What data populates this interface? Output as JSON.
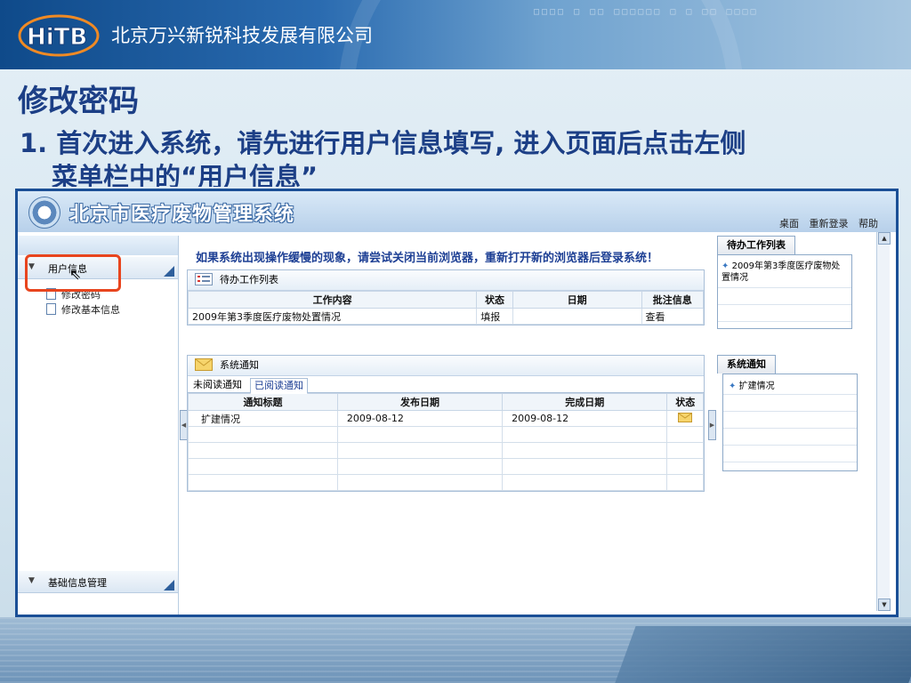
{
  "slide": {
    "company": "北京万兴新锐科技发展有限公司",
    "logo_text": "HiTB",
    "heading": "修改密码",
    "step_line1": "1. 首次进入系统，请先进行用户信息填写, 进入页面后点击左侧",
    "step_line2": "菜单栏中的“用户信息”"
  },
  "app": {
    "title": "北京市医疗废物管理系统",
    "top_links": [
      "桌面",
      "重新登录",
      "帮助"
    ],
    "sidebar": {
      "section1": "用户信息",
      "items": [
        "修改密码",
        "修改基本信息"
      ],
      "section2": "基础信息管理"
    },
    "notice": "如果系统出现操作缓慢的现象，请尝试关闭当前浏览器，重新打开新的浏览器后登录系统！",
    "todo_panel": {
      "title": "待办工作列表",
      "headers": [
        "工作内容",
        "状态",
        "日期",
        "批注信息"
      ],
      "rows": [
        [
          "2009年第3季度医疗废物处置情况",
          "填报",
          "",
          "查看"
        ]
      ]
    },
    "notice_panel": {
      "title": "系统通知",
      "tabs": [
        "未阅读通知",
        "已阅读通知"
      ],
      "headers": [
        "通知标题",
        "发布日期",
        "完成日期",
        "状态"
      ],
      "rows": [
        [
          "扩建情况",
          "2009-08-12",
          "2009-08-12",
          ""
        ]
      ]
    },
    "right": {
      "todo_tab": "待办工作列表",
      "todo_items": [
        "2009年第3季度医疗废物处置情况"
      ],
      "notice_tab": "系统通知",
      "notice_items": [
        "扩建情况"
      ]
    }
  },
  "colors": {
    "accent": "#1d3f94",
    "highlight": "#e8451e",
    "banner": "#0f4a8a"
  }
}
